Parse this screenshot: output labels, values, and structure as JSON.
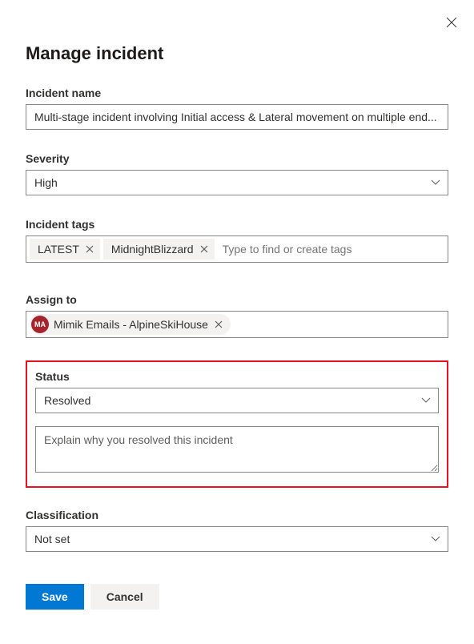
{
  "title": "Manage incident",
  "fields": {
    "incidentName": {
      "label": "Incident name",
      "value": "Multi-stage incident involving Initial access & Lateral movement on multiple end..."
    },
    "severity": {
      "label": "Severity",
      "value": "High"
    },
    "tags": {
      "label": "Incident tags",
      "items": [
        "LATEST",
        "MidnightBlizzard"
      ],
      "placeholder": "Type to find or create tags"
    },
    "assignTo": {
      "label": "Assign to",
      "assignee": {
        "initials": "MA",
        "name": "Mimik Emails - AlpineSkiHouse"
      }
    },
    "status": {
      "label": "Status",
      "value": "Resolved",
      "commentPlaceholder": "Explain why you resolved this incident"
    },
    "classification": {
      "label": "Classification",
      "value": "Not set"
    }
  },
  "buttons": {
    "save": "Save",
    "cancel": "Cancel"
  }
}
